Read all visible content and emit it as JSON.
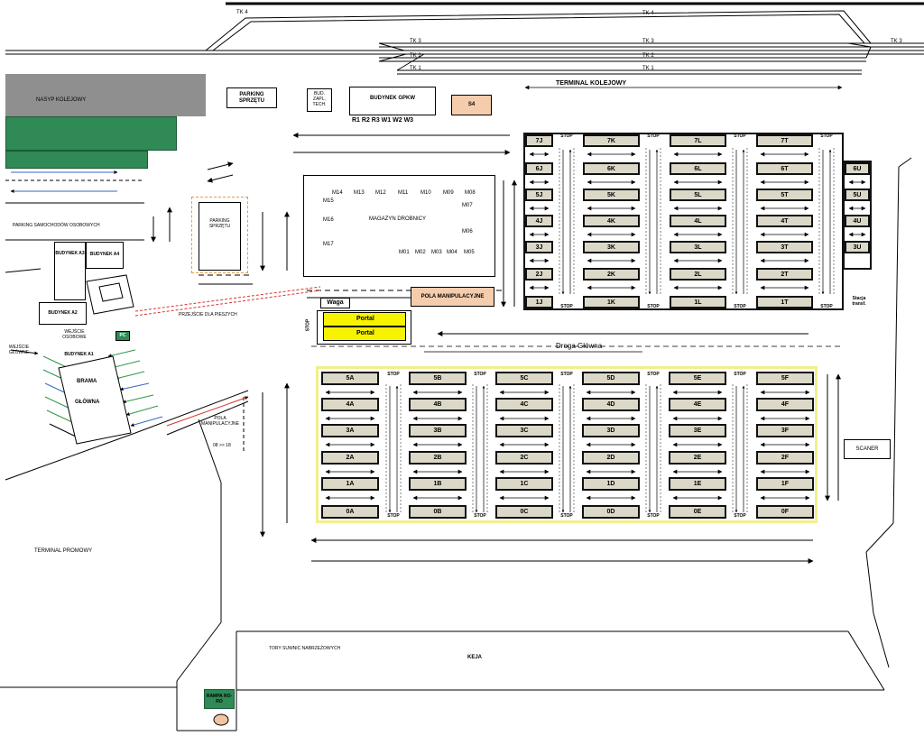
{
  "tracks": {
    "tk4_left": "TK 4",
    "tk4_mid": "TK 4",
    "tk3_left": "TK 3",
    "tk3_mid": "TK 3",
    "tk3_right": "TK 3",
    "tk2": "TK 2",
    "tk1_left": "TK 1",
    "tk1_mid": "TK 1"
  },
  "rail_terminal_label": "TERMINAL KOLEJOWY",
  "buildings": {
    "nasyp": "NASYP KOLEJOWY",
    "parking_sprzetu_top": "PARKING SPRZĘTU",
    "bud_zapl": "BUD. ZAPL. TECH.",
    "gpkw": "BUDYNEK GPKW",
    "s4": "S4",
    "gpkw_gates": "R1  R2  R3     W1  W2  W3",
    "parking_osob": "PARKING SAMOCHODÓW OSOBOWYCH",
    "parking_sprzetu_left": "PARKING SPRZĘTU",
    "budynek_a3": "BUDYNEK A3",
    "budynek_a4": "BUDYNEK  A4",
    "budynek_a2": "BUDYNEK A2",
    "wejscie_osobowe": "WEJŚCIE OSOBOWE",
    "budynek_a1": "BUDYNEK A1",
    "wejscie_glowne": "WEJŚCIE GŁÓWNE",
    "brama": "BRAMA",
    "glowna": "GŁÓWNA",
    "pc": "PC",
    "przejscie": "PRZEJŚCIE DLA PIESZYCH",
    "pola_manip_left": "POLA MANIPULACYJNE",
    "pola_hours": "08 >> 18",
    "terminal_promowy": "TERMINAL PROMOWY",
    "tory_suwnic": "TORY SUWNIC NABRZEŻOWYCH",
    "keja": "KEJA",
    "rampa": "RAMPA RO-RO",
    "scaner": "SCANER",
    "stacja": "Stacja transf.",
    "droga": "Droga Główna"
  },
  "warehouse": {
    "title": "MAGAZYN DROBNICY",
    "top_bays": [
      "M14",
      "M13",
      "M12",
      "M11",
      "M10",
      "M09",
      "M08"
    ],
    "left_bays": [
      "M15",
      "M16",
      "M17"
    ],
    "right_bays": [
      "M07",
      "M06"
    ],
    "bottom_bays": [
      "M01",
      "M02",
      "M03",
      "M04",
      "M05"
    ]
  },
  "pola_manip_right": "POLA MANIPULACYJNE",
  "waga": "Waga",
  "portal_1": "Portal",
  "portal_2": "Portal",
  "stop_word": "STOP",
  "rail_yard": {
    "columns": [
      {
        "rows": [
          "7J",
          "6J",
          "5J",
          "4J",
          "3J",
          "2J",
          "1J"
        ]
      },
      {
        "rows": [
          "7K",
          "6K",
          "5K",
          "4K",
          "3K",
          "2K",
          "1K"
        ]
      },
      {
        "rows": [
          "7L",
          "6L",
          "5L",
          "4L",
          "3L",
          "2L",
          "1L"
        ]
      },
      {
        "rows": [
          "7T",
          "6T",
          "5T",
          "4T",
          "3T",
          "2T",
          "1T"
        ]
      }
    ],
    "extra": [
      "6U",
      "5U",
      "4U",
      "3U"
    ]
  },
  "port_yard": {
    "columns": [
      {
        "rows": [
          "5A",
          "4A",
          "3A",
          "2A",
          "1A",
          "0A"
        ]
      },
      {
        "rows": [
          "5B",
          "4B",
          "3B",
          "2B",
          "1B",
          "0B"
        ]
      },
      {
        "rows": [
          "5C",
          "4C",
          "3C",
          "2C",
          "1C",
          "0C"
        ]
      },
      {
        "rows": [
          "5D",
          "4D",
          "3D",
          "2D",
          "1D",
          "0D"
        ]
      },
      {
        "rows": [
          "5E",
          "4E",
          "3E",
          "2E",
          "1E",
          "0E"
        ]
      },
      {
        "rows": [
          "5F",
          "4F",
          "3F",
          "2F",
          "1F",
          "0F"
        ]
      }
    ]
  }
}
